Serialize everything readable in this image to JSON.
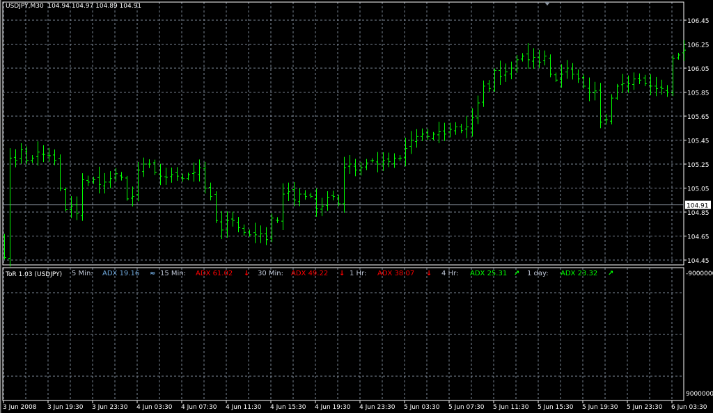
{
  "header": {
    "symbol": "USDJPY,M30",
    "open": "104.94",
    "high": "104.97",
    "low": "104.89",
    "close": "104.91"
  },
  "current_price_label": "104.91",
  "indicator": {
    "name": "ToR 1.03 (USDJPY)",
    "rows": [
      {
        "tf": "5 Min:",
        "adx": "ADX 19.16",
        "arrow": "≈",
        "color": "#6fa8dc"
      },
      {
        "tf": "15 Min:",
        "adx": "ADX 61.02",
        "arrow": "↓",
        "color": "#ff0000"
      },
      {
        "tf": "30 Min:",
        "adx": "ADX 49.22",
        "arrow": "↓",
        "color": "#ff0000"
      },
      {
        "tf": "1 Hr:",
        "adx": "ADX 38.07",
        "arrow": "↓",
        "color": "#ff0000"
      },
      {
        "tf": "4 Hr:",
        "adx": "ADX 25.31",
        "arrow": "↗",
        "color": "#00ff00"
      },
      {
        "tf": "1 day:",
        "adx": "ADX 23.32",
        "arrow": "↗",
        "color": "#00ff00"
      }
    ],
    "scale_top": "-9000000",
    "scale_bottom": "9000000"
  },
  "chart_data": {
    "type": "ohlc-bar",
    "symbol": "USDJPY",
    "timeframe": "M30",
    "ylim": [
      104.4,
      106.55
    ],
    "y_ticks": [
      "106.45",
      "106.25",
      "106.05",
      "105.85",
      "105.65",
      "105.45",
      "105.25",
      "105.05",
      "104.85",
      "104.65",
      "104.45"
    ],
    "x_ticks": [
      "3 Jun 2008",
      "3 Jun 19:30",
      "3 Jun 23:30",
      "4 Jun 03:30",
      "4 Jun 07:30",
      "4 Jun 11:30",
      "4 Jun 15:30",
      "4 Jun 19:30",
      "4 Jun 23:30",
      "5 Jun 03:30",
      "5 Jun 07:30",
      "5 Jun 11:30",
      "5 Jun 15:30",
      "5 Jun 19:30",
      "5 Jun 23:30",
      "6 Jun 03:30"
    ],
    "closes": [
      104.47,
      105.3,
      105.28,
      105.37,
      105.28,
      105.3,
      105.35,
      105.33,
      105.32,
      105.28,
      105.05,
      104.87,
      104.9,
      104.84,
      105.12,
      105.1,
      105.12,
      105.08,
      105.1,
      105.13,
      105.17,
      105.14,
      104.96,
      104.98,
      105.2,
      105.25,
      105.25,
      105.18,
      105.15,
      105.14,
      105.16,
      105.15,
      105.13,
      105.16,
      105.18,
      105.22,
      105.05,
      104.98,
      104.78,
      104.7,
      104.78,
      104.78,
      104.72,
      104.68,
      104.66,
      104.66,
      104.67,
      104.62,
      104.8,
      104.78,
      105.0,
      105.02,
      104.95,
      105.0,
      104.98,
      104.98,
      104.88,
      104.9,
      104.97,
      104.98,
      104.92,
      105.22,
      105.25,
      105.2,
      105.22,
      105.26,
      105.28,
      105.25,
      105.28,
      105.27,
      105.3,
      105.3,
      105.38,
      105.45,
      105.48,
      105.5,
      105.48,
      105.5,
      105.52,
      105.5,
      105.54,
      105.56,
      105.53,
      105.56,
      105.64,
      105.76,
      105.9,
      105.88,
      106.03,
      105.98,
      106.02,
      106.05,
      106.12,
      106.15,
      106.12,
      106.14,
      106.1,
      106.15,
      106.0,
      105.95,
      106.0,
      106.05,
      106.0,
      105.96,
      105.9,
      105.85,
      105.86,
      105.6,
      105.62,
      105.8,
      105.9,
      105.92,
      105.92,
      105.96,
      105.95,
      105.92,
      105.9,
      105.88,
      105.88,
      105.85,
      106.13,
      106.16,
      106.2
    ],
    "bar_color": "#00ff00",
    "grid": true
  }
}
